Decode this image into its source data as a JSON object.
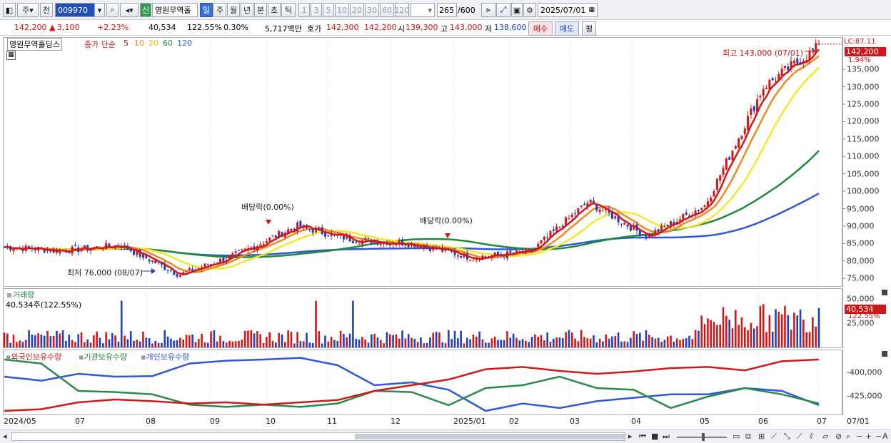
{
  "toolbar": {
    "market": "주",
    "prev": "전",
    "code": "009970",
    "shin": "신",
    "stock_name": "영원무역홀",
    "periods": [
      "일",
      "주",
      "월",
      "년",
      "분",
      "초",
      "틱"
    ],
    "intervals": [
      "1",
      "3",
      "5",
      "10",
      "20",
      "30",
      "60",
      "120"
    ],
    "count_value": "265",
    "count_total": "/600",
    "date": "2025/07/01"
  },
  "quote": {
    "price": "142,200",
    "change": "3,100",
    "change_pct": "+2.23%",
    "volume": "40,534",
    "vol_ratio": "122.55%",
    "turnover": "0.30%",
    "amount": "5,717백만",
    "hoga_label": "호가",
    "ask": "142,300",
    "bid": "142,200",
    "open_label": "시",
    "open": "139,300",
    "high_label": "고",
    "high": "143,000",
    "low_label": "저",
    "low": "138,600",
    "buy_label": "매수",
    "sell_label": "매도",
    "avg_label": "평"
  },
  "price_pane": {
    "name_tag": "영원무역홀딩스",
    "ma_label": "종가 단순",
    "ma_periods": [
      "5",
      "10",
      "20",
      "60",
      "120"
    ],
    "ma_colors": [
      "#d01818",
      "#f08a20",
      "#f5e82a",
      "#1e8a3a",
      "#2e58d8"
    ],
    "lc_label": "LC:87.11",
    "cur_price_tag": "142,200",
    "cur_pct_tag": "1.94%",
    "high_note": "최고 143,000 (07/01)",
    "low_note": "최저 76,000 (08/07)",
    "div_note1": "배당락(0.00%)",
    "div_note2": "배당락(0.00%)",
    "yticks": [
      "135,000",
      "130,000",
      "125,000",
      "120,000",
      "115,000",
      "110,000",
      "105,000",
      "100,000",
      "95,000",
      "90,000",
      "85,000",
      "80,000",
      "75,000"
    ]
  },
  "volume_pane": {
    "title": "거래량",
    "readout": "40,534주(122.55%)",
    "yticks": [
      "50,000",
      "25,000"
    ],
    "tag_value": "40,534",
    "tag_pct": "122.55%"
  },
  "holding_pane": {
    "legend": [
      "외국인보유수량",
      "기관보유수량",
      "개인보유수량"
    ],
    "colors": [
      "#d01818",
      "#1e8a3a",
      "#2e58d8"
    ],
    "yticks": [
      "-400,000",
      "-425,000"
    ]
  },
  "x_axis": {
    "labels": [
      "2024/05",
      "07",
      "08",
      "09",
      "10",
      "11",
      "12",
      "2025/01",
      "02",
      "03",
      "04",
      "05",
      "06",
      "07"
    ],
    "right_label": "07/01"
  },
  "chart_data": {
    "type": "candlestick",
    "period": "2024/05 – 2025/07/01 (daily)",
    "price_points": [
      [
        "2024/05",
        84000
      ],
      [
        "2024/06",
        83000
      ],
      [
        "2024/07",
        84500
      ],
      [
        "2024/08",
        76000
      ],
      [
        "2024/09",
        82000
      ],
      [
        "2024/10",
        90000
      ],
      [
        "2024/11",
        86000
      ],
      [
        "2024/12",
        85000
      ],
      [
        "2025/01",
        81000
      ],
      [
        "2025/02",
        82500
      ],
      [
        "2025/03",
        97000
      ],
      [
        "2025/04",
        87000
      ],
      [
        "2025/05",
        96000
      ],
      [
        "2025/06",
        130000
      ],
      [
        "2025/07",
        142200
      ]
    ],
    "ylim": [
      73000,
      143000
    ],
    "volume_ylim": [
      0,
      55000
    ]
  }
}
